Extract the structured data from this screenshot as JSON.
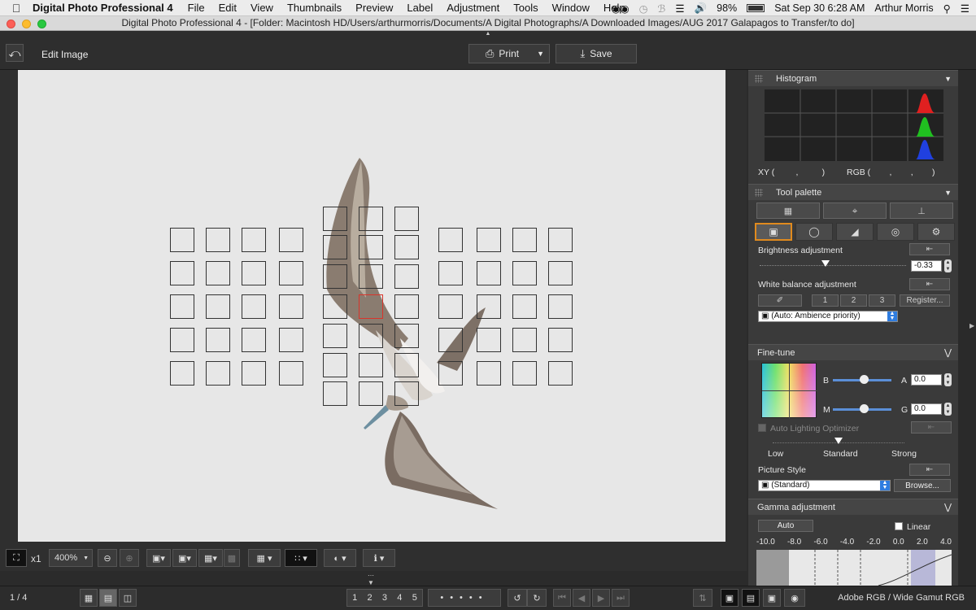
{
  "menubar": {
    "app_name": "Digital Photo Professional 4",
    "items": [
      "File",
      "Edit",
      "View",
      "Thumbnails",
      "Preview",
      "Label",
      "Adjustment",
      "Tools",
      "Window",
      "Help"
    ],
    "battery": "98%",
    "datetime": "Sat Sep 30  6:28 AM",
    "user": "Arthur Morris"
  },
  "window": {
    "title": "Digital Photo Professional 4 - [Folder: Macintosh HD/Users/arthurmorris/Documents/A Digital Photographs/A Downloaded Images/AUG 2017 Galapagos to Transfer/to do]"
  },
  "toolbar": {
    "edit_image_label": "Edit Image",
    "print_label": "Print",
    "save_label": "Save"
  },
  "histogram": {
    "title": "Histogram",
    "xy_label": "XY (         ,          )",
    "rgb_label": "RGB (        ,        ,        )"
  },
  "tool_palette": {
    "title": "Tool palette",
    "brightness_label": "Brightness adjustment",
    "brightness_value": "-0.33",
    "wb_label": "White balance adjustment",
    "wb_slots": [
      "1",
      "2",
      "3"
    ],
    "register_label": "Register...",
    "wb_preset": "(Auto: Ambience priority)"
  },
  "fine_tune": {
    "title": "Fine-tune",
    "b_label": "B",
    "a_label": "A",
    "a_value": "0.0",
    "m_label": "M",
    "g_label": "G",
    "g_value": "0.0",
    "alo_label": "Auto Lighting Optimizer",
    "alo_levels": [
      "Low",
      "Standard",
      "Strong"
    ],
    "picture_style_label": "Picture Style",
    "picture_style_value": "(Standard)",
    "browse_label": "Browse..."
  },
  "gamma": {
    "title": "Gamma adjustment",
    "auto_label": "Auto",
    "linear_label": "Linear",
    "scale": [
      "-10.0",
      "-8.0",
      "-6.0",
      "-4.0",
      "-2.0",
      "0.0",
      "2.0",
      "4.0"
    ]
  },
  "view_controls": {
    "x1_label": "x1",
    "zoom_value": "400%"
  },
  "status": {
    "page_counter": "1 / 4",
    "ratings": [
      "1",
      "2",
      "3",
      "4",
      "5"
    ],
    "color_space": "Adobe RGB / Wide Gamut RGB"
  },
  "colors": {
    "accent_orange": "#e08a1e",
    "af_active": "#d9342b",
    "panel_bg": "#3a3a3a"
  }
}
